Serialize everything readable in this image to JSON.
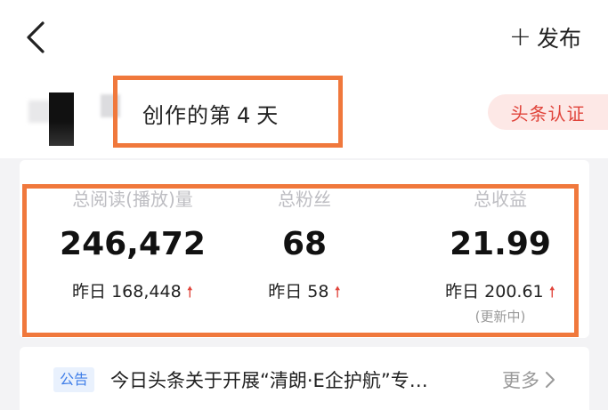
{
  "header": {
    "back_icon": "chevron-left-icon",
    "publish_plus": "+",
    "publish_label": "发布"
  },
  "profile": {
    "days_prefix": "创作的第",
    "days_number": "4",
    "days_suffix": "天",
    "verify_label": "头条认证"
  },
  "stats": [
    {
      "label": "总阅读(播放)量",
      "value": "246,472",
      "yesterday_label": "昨日",
      "yesterday_value": "168,448",
      "trend": "up"
    },
    {
      "label": "总粉丝",
      "value": "68",
      "yesterday_label": "昨日",
      "yesterday_value": "58",
      "trend": "up"
    },
    {
      "label": "总收益",
      "value": "21.99",
      "yesterday_label": "昨日",
      "yesterday_value": "200.61",
      "trend": "up",
      "note": "(更新中)"
    }
  ],
  "notice": {
    "tag": "公告",
    "text": "今日头条关于开展“清朗·E企护航”专…",
    "more": "更多"
  },
  "colors": {
    "accent_red": "#e0443b",
    "highlight_orange": "#f0783c",
    "notice_blue": "#3f7ee8"
  }
}
